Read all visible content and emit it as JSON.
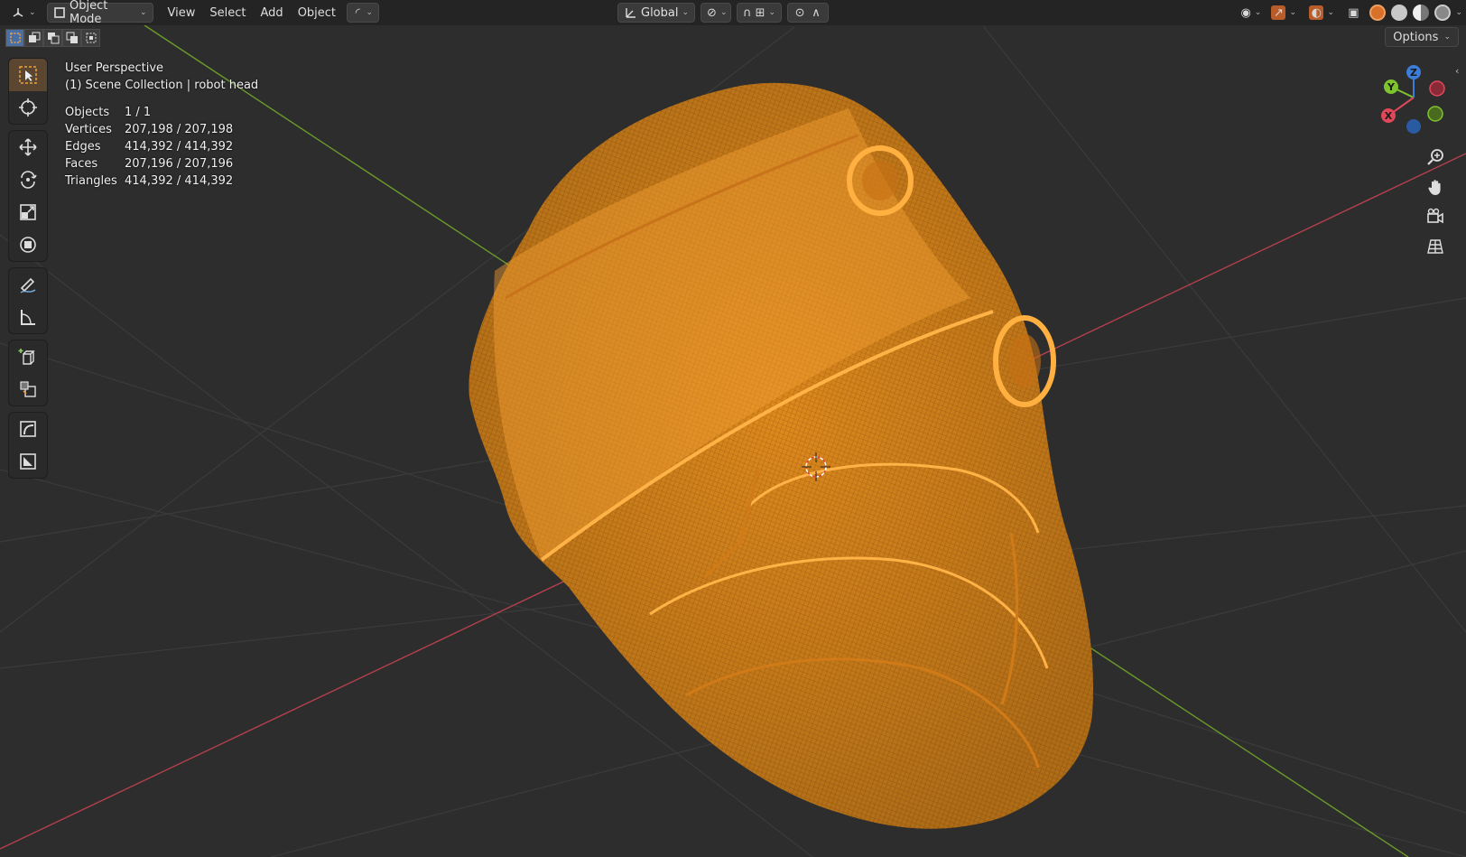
{
  "header": {
    "editor_icon": "view3d-icon",
    "mode_label": "Object Mode",
    "menus": [
      "View",
      "Select",
      "Add",
      "Object"
    ],
    "transform_orientation": "Global",
    "options_label": "Options"
  },
  "overlay": {
    "view_name": "User Perspective",
    "collection_line": "(1) Scene Collection | robot head",
    "stats": [
      {
        "label": "Objects",
        "value": "1 / 1"
      },
      {
        "label": "Vertices",
        "value": "207,198 / 207,198"
      },
      {
        "label": "Edges",
        "value": "414,392 / 414,392"
      },
      {
        "label": "Faces",
        "value": "207,196 / 207,196"
      },
      {
        "label": "Triangles",
        "value": "414,392 / 414,392"
      }
    ]
  },
  "gizmo": {
    "x_label": "X",
    "y_label": "Y",
    "z_label": "Z",
    "x_color": "#e0485a",
    "y_color": "#7dc42e",
    "z_color": "#3b7dd8"
  },
  "toolbar": {
    "tools": [
      "select-box",
      "cursor",
      "move",
      "rotate",
      "scale",
      "transform",
      "annotate",
      "measure",
      "add-cube",
      "add-object",
      "shear",
      "quad"
    ],
    "active_tool": "select-box"
  },
  "colors": {
    "mesh": "#f0982a",
    "viewport_bg": "#2d2d2d",
    "x_axis": "#b3404c",
    "y_axis": "#6a9a2a",
    "grid": "#3c3c3c"
  }
}
